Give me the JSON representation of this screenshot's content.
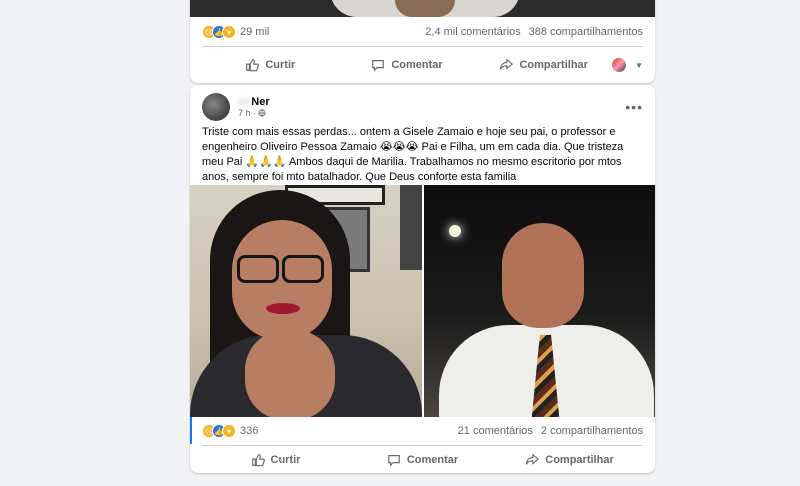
{
  "top_post": {
    "reactions_count": "29 mil",
    "comments": "2,4 mil comentários",
    "shares": "388 compartilhamentos",
    "actions": {
      "like": "Curtir",
      "comment": "Comentar",
      "share": "Compartilhar"
    }
  },
  "post": {
    "author": "Ner",
    "time": "7 h ·",
    "text": "Triste com mais essas perdas... ontem a Gisele Zamaio e hoje seu pai, o professor e engenheiro Oliveiro Pessoa Zamaio 😭😭😭 Pai e Filha, um em cada dia. Que tristeza meu Pai 🙏🙏🙏 Ambos daqui de Marilia. Trabalhamos no mesmo escritorio por mtos anos, sempre foi mto batalhador. Que Deus conforte esta familia",
    "reactions_count": "336",
    "comments": "21 comentários",
    "shares": "2 compartilhamentos",
    "actions": {
      "like": "Curtir",
      "comment": "Comentar",
      "share": "Compartilhar"
    }
  },
  "icons": {
    "reactions": [
      "sad-icon",
      "like-icon",
      "care-icon"
    ],
    "like": "thumbs-up-icon",
    "comment": "speech-bubble-icon",
    "share": "share-arrow-icon",
    "more": "more-options-icon",
    "privacy": "globe-icon"
  },
  "colors": {
    "like_blue": "#1877f2",
    "muted_text": "#65676b",
    "background": "#f0f2f5"
  }
}
